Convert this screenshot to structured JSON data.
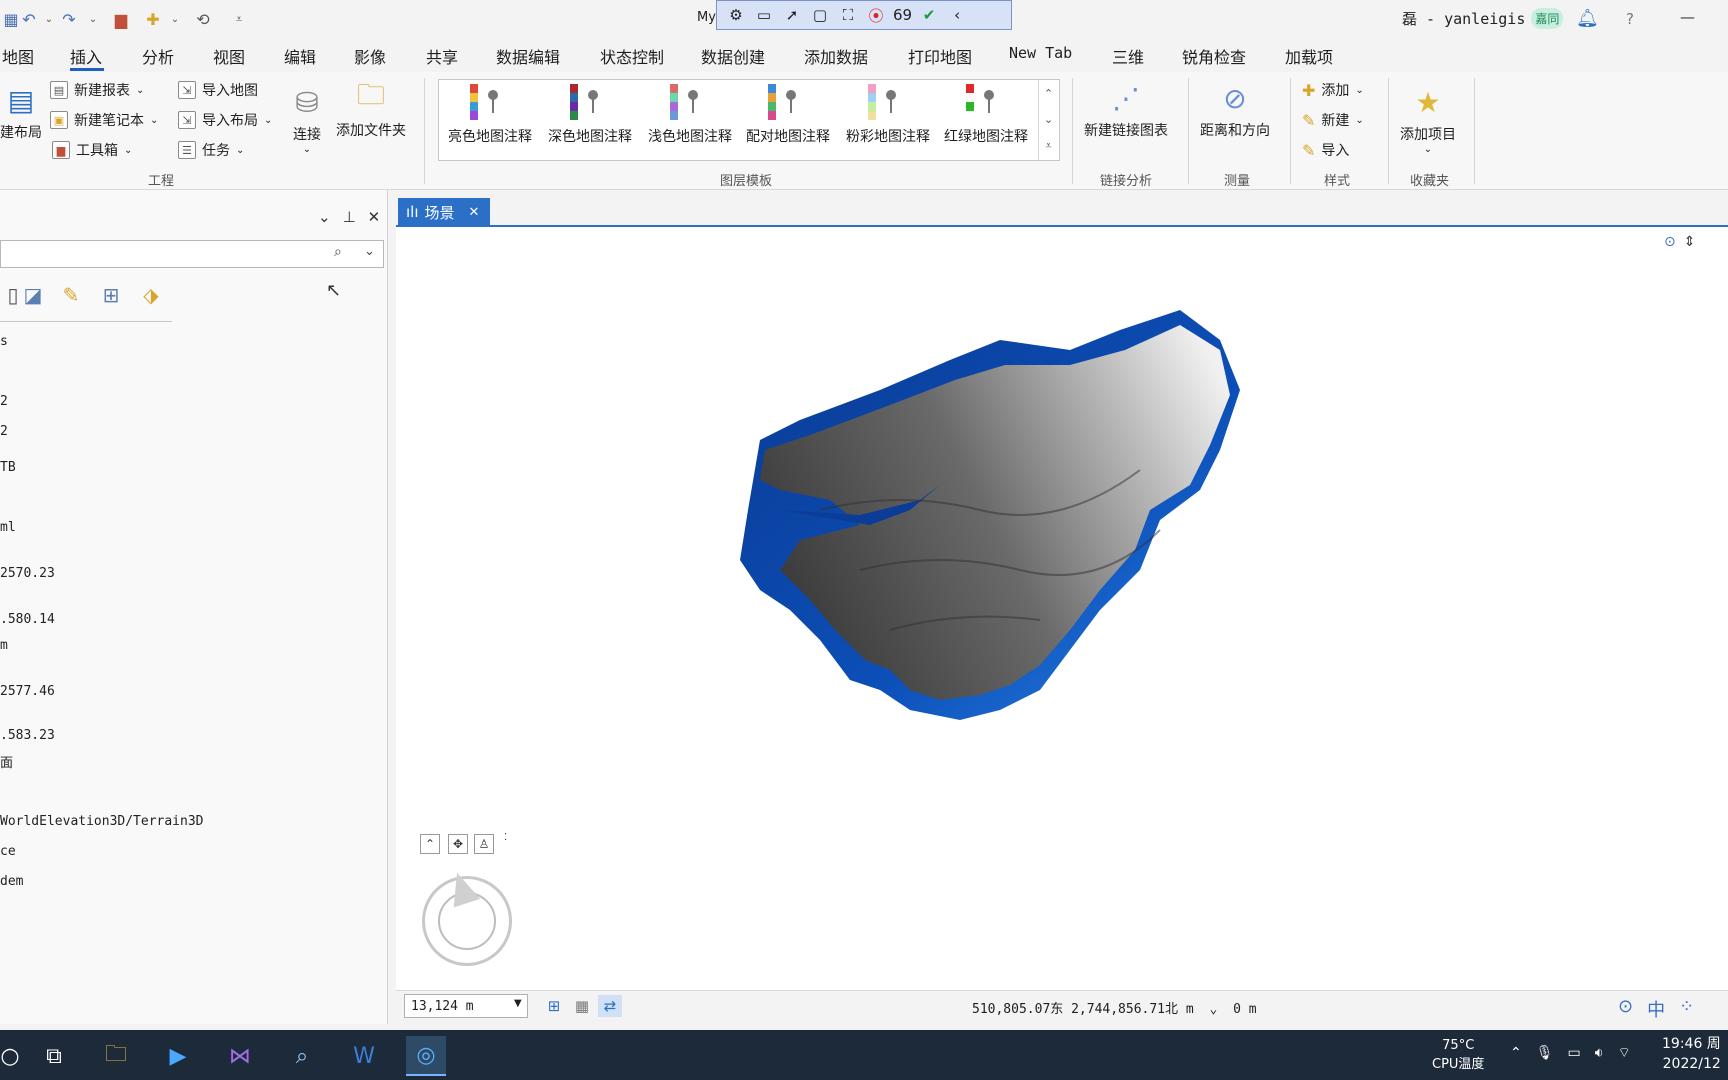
{
  "window": {
    "doc_title": "My",
    "record_count": "69",
    "user": "磊 - yanleigis",
    "user_badge": "嘉同",
    "help": "?",
    "minimize": "—"
  },
  "menu": [
    "地图",
    "插入",
    "分析",
    "视图",
    "编辑",
    "影像",
    "共享",
    "数据编辑",
    "状态控制",
    "数据创建",
    "添加数据",
    "打印地图",
    "New Tab",
    "三维",
    "锐角检查",
    "加载项"
  ],
  "menu_active": "插入",
  "ribbon": {
    "new_layout": "建布局",
    "new_report": "新建报表",
    "new_notebook": "新建笔记本",
    "toolbox": "工具箱",
    "import_map": "导入地图",
    "import_layout": "导入布局",
    "task": "任务",
    "connect": "连接",
    "add_folder": "添加文件夹",
    "group_project": "工程",
    "gallery": [
      "亮色地图注释",
      "深色地图注释",
      "浅色地图注释",
      "配对地图注释",
      "粉彩地图注释",
      "红绿地图注释"
    ],
    "group_layer_template": "图层模板",
    "new_link_chart": "新建链接图表",
    "group_link": "链接分析",
    "distance_direction": "距离和方向",
    "group_measure": "测量",
    "style_add": "添加",
    "style_new": "新建",
    "style_import": "导入",
    "group_style": "样式",
    "add_item": "添加项目",
    "group_favorites": "收藏夹"
  },
  "left_pane": {
    "search_placeholder": "",
    "lines": [
      "s",
      "2",
      "2",
      "TB",
      "ml",
      "2570.23",
      ".580.14",
      "m",
      "2577.46",
      ".583.23",
      "面",
      "WorldElevation3D/Terrain3D",
      "ce",
      "dem"
    ]
  },
  "scene": {
    "tab_label": "场景",
    "close": "✕"
  },
  "status": {
    "scale": "13,124 m",
    "coords": "510,805.07东  2,744,856.71北 m",
    "elevation": "0 m",
    "ime_mode": "中"
  },
  "taskbar": {
    "temp": "75°C",
    "temp_label": "CPU温度",
    "time": "19:46 周",
    "date": "2022/12"
  }
}
